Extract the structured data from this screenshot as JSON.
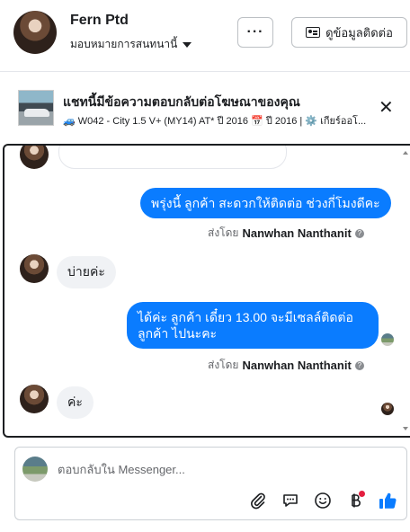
{
  "header": {
    "name": "Fern Ptd",
    "assign_label": "มอบหมายการสนทนานี้",
    "more_label": "···",
    "contact_label": "ดูข้อมูลติดต่อ"
  },
  "ad": {
    "title": "แชทนี้มีข้อความตอบกลับต่อโฆษณาของคุณ",
    "subtitle": "🚙 W042 - City 1.5 V+ (MY14) AT* ปี 2016 📅 ปี 2016 | ⚙️ เกียร์ออโ...",
    "close_label": "✕"
  },
  "messages": [
    {
      "direction": "out",
      "text": "พรุ่งนี้ ลูกค้า สะดวกให้ติดต่อ ช่วงกี่โมงดีคะ",
      "sent_by_prefix": "ส่งโดย",
      "sent_by_name": "Nanwhan Nanthanit"
    },
    {
      "direction": "in",
      "text": "บ่ายค่ะ"
    },
    {
      "direction": "out",
      "line1": "ได้ค่ะ  ลูกค้า  เดี๋ยว 13.00 จะมีเซลล์ติดต่อ",
      "line2": "ลูกค้า  ไปนะคะ",
      "sent_by_prefix": "ส่งโดย",
      "sent_by_name": "Nanwhan Nanthanit"
    },
    {
      "direction": "in",
      "text": "ค่ะ"
    }
  ],
  "composer": {
    "placeholder": "ตอบกลับใน Messenger..."
  },
  "icons": [
    "attach-icon",
    "saved-reply-icon",
    "emoji-icon",
    "payment-icon",
    "like-icon"
  ],
  "colors": {
    "outgoing_bubble": "#0a7cff",
    "incoming_bubble": "#f0f2f5",
    "like": "#0a7cff"
  }
}
